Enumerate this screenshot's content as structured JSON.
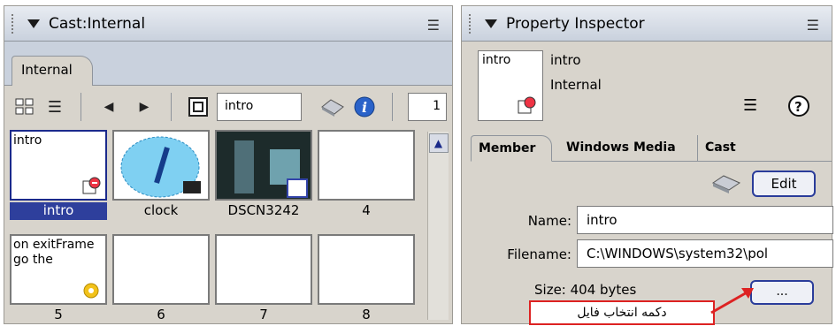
{
  "cast": {
    "title": "Cast:Internal",
    "tab_label": "Internal",
    "name_field": "intro",
    "number_field": "1",
    "members": [
      {
        "text": "intro",
        "label": "intro",
        "selected": true
      },
      {
        "text": "",
        "label": "clock",
        "selected": false
      },
      {
        "text": "",
        "label": "DSCN3242",
        "selected": false
      },
      {
        "text": "",
        "label": "4",
        "selected": false
      },
      {
        "text": "on exitFrame\ngo the",
        "label": "5",
        "selected": false
      },
      {
        "text": "",
        "label": "6",
        "selected": false
      },
      {
        "text": "",
        "label": "7",
        "selected": false
      },
      {
        "text": "",
        "label": "8",
        "selected": false
      }
    ]
  },
  "inspector": {
    "title": "Property Inspector",
    "thumb_text": "intro",
    "member_name": "intro",
    "cast_name": "Internal",
    "tabs": [
      "Member",
      "Windows Media",
      "Cast"
    ],
    "edit_label": "Edit",
    "name_label": "Name:",
    "name_value": "intro",
    "filename_label": "Filename:",
    "filename_value": "C:\\WINDOWS\\system32\\pol",
    "size_text": "Size: 404 bytes",
    "browse_label": "...",
    "callout_text": "دکمه انتخاب فایل"
  },
  "colors": {
    "selection": "#2e3f9c",
    "callout_border": "#dd2222"
  }
}
